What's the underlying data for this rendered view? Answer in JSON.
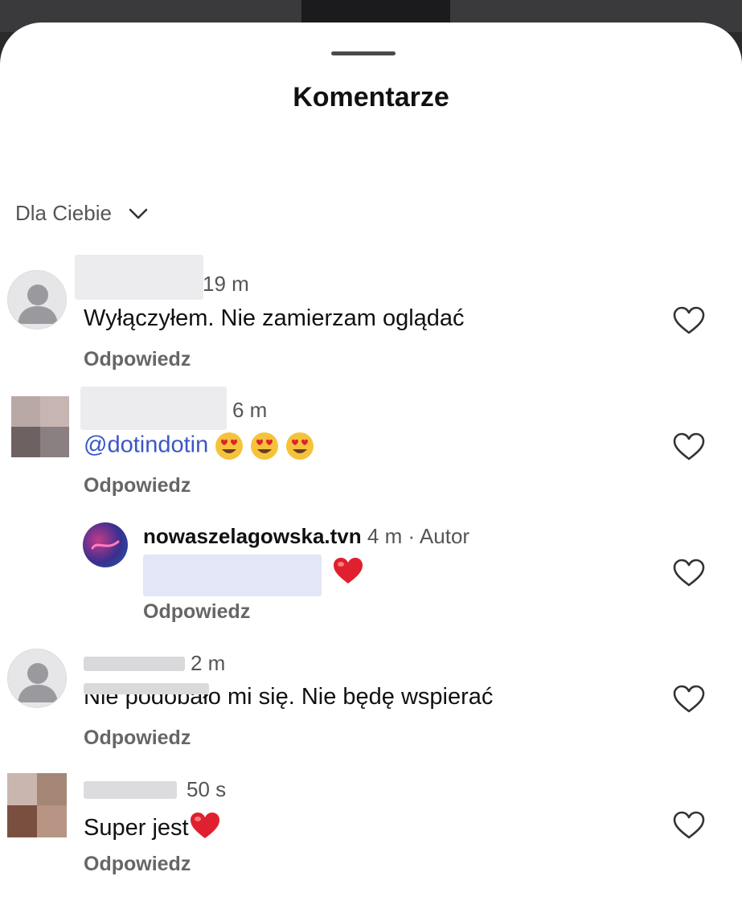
{
  "sheet": {
    "title": "Komentarze"
  },
  "sort": {
    "label": "Dla Ciebie"
  },
  "comments": [
    {
      "time": "19 m",
      "text": "Wyłączyłem. Nie zamierzam oglądać",
      "reply": "Odpowiedz"
    },
    {
      "time": "6 m",
      "mention": "@dotindotin",
      "reply": "Odpowiedz"
    },
    {
      "username": "nowaszelagowska.tvn",
      "time": "4 m",
      "author_label": "· Autor",
      "reply": "Odpowiedz"
    },
    {
      "time": "2 m",
      "text": "Nie podobało mi się. Nie będę wspierać",
      "reply": "Odpowiedz"
    },
    {
      "time": "50 s",
      "text": "Super jest",
      "reply": "Odpowiedz"
    }
  ],
  "colors": {
    "mention": "#3b57c4",
    "heart_red": "#e0202e",
    "muted": "#666666"
  }
}
